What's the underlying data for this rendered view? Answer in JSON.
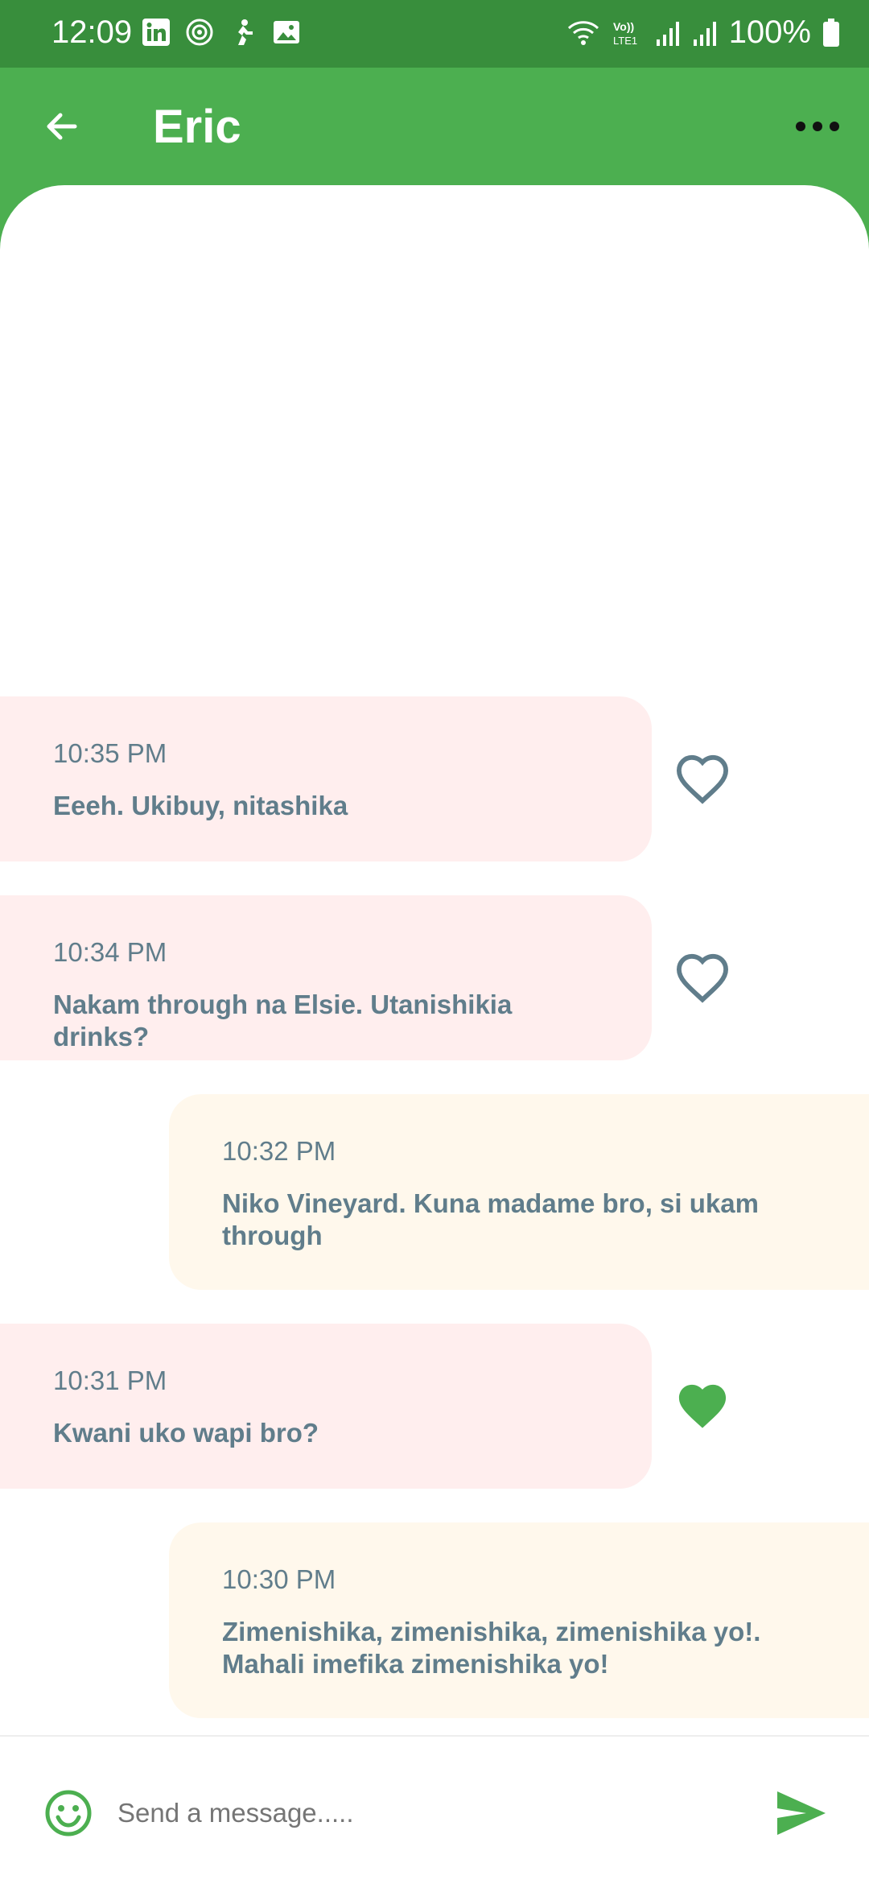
{
  "status_bar": {
    "time": "12:09",
    "battery": "100%",
    "left_icons": [
      "linkedin-icon",
      "crest-icon",
      "activity-icon",
      "image-icon"
    ],
    "right_icons": [
      "wifi-icon",
      "volte-icon",
      "signal-icon",
      "signal-icon",
      "battery-icon"
    ]
  },
  "header": {
    "title": "Eric",
    "back_icon": "arrow-back-icon",
    "menu_icon": "more-horizontal-icon"
  },
  "messages": [
    {
      "time": "10:35 PM",
      "text": "Eeeh. Ukibuy, nitashika",
      "direction": "incoming",
      "liked": false
    },
    {
      "time": "10:34 PM",
      "text": "Nakam through na Elsie. Utanishikia drinks?",
      "direction": "incoming",
      "liked": false
    },
    {
      "time": "10:32 PM",
      "text": "Niko Vineyard. Kuna madame bro, si ukam through",
      "direction": "outgoing"
    },
    {
      "time": "10:31 PM",
      "text": "Kwani uko wapi bro?",
      "direction": "incoming",
      "liked": true
    },
    {
      "time": "10:30 PM",
      "text": "Zimenishika, zimenishika, zimenishika yo!. Mahali imefika zimenishika yo!",
      "direction": "outgoing"
    }
  ],
  "composer": {
    "placeholder": "Send a message.....",
    "value": "",
    "emoji_icon": "emoji-icon",
    "send_icon": "send-icon"
  },
  "colors": {
    "primary": "#4CAF50",
    "status_bar": "#388E3C",
    "incoming_bubble": "#FFEEEE",
    "outgoing_bubble": "#FFF8EC",
    "message_text": "#607D8B",
    "heart_outline": "#607D8B",
    "heart_filled": "#4CAF50"
  }
}
